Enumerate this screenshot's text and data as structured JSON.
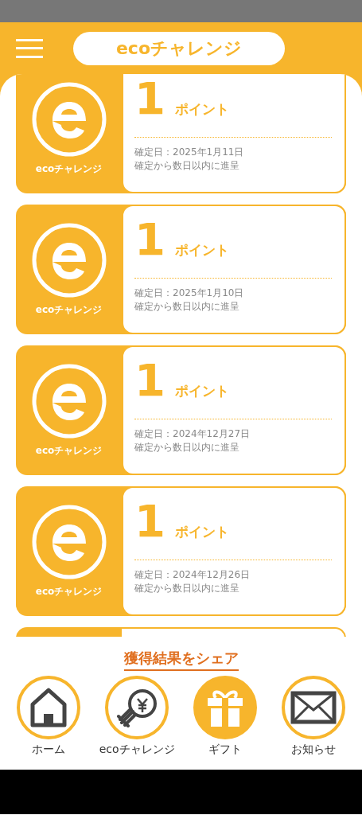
{
  "header": {
    "title": "ecoチャレンジ"
  },
  "cards": [
    {
      "logo_label": "ecoチャレンジ",
      "points": "1",
      "unit": "ポイント",
      "date": "確定日：2025年1月11日",
      "note": "確定から数日以内に進呈"
    },
    {
      "logo_label": "ecoチャレンジ",
      "points": "1",
      "unit": "ポイント",
      "date": "確定日：2025年1月10日",
      "note": "確定から数日以内に進呈"
    },
    {
      "logo_label": "ecoチャレンジ",
      "points": "1",
      "unit": "ポイント",
      "date": "確定日：2024年12月27日",
      "note": "確定から数日以内に進呈"
    },
    {
      "logo_label": "ecoチャレンジ",
      "points": "1",
      "unit": "ポイント",
      "date": "確定日：2024年12月26日",
      "note": "確定から数日以内に進呈"
    }
  ],
  "share_link": "獲得結果をシェア",
  "nav": [
    {
      "kind": "home",
      "label": "ホーム",
      "selected": false
    },
    {
      "kind": "eco",
      "label": "ecoチャレンジ",
      "selected": false
    },
    {
      "kind": "gift",
      "label": "ギフト",
      "selected": true
    },
    {
      "kind": "mail",
      "label": "お知らせ",
      "selected": false
    }
  ]
}
